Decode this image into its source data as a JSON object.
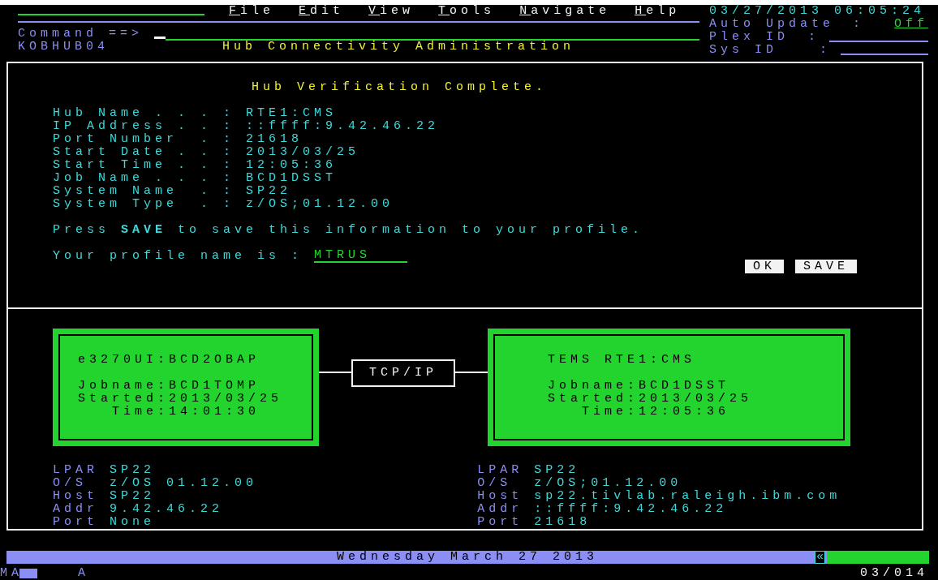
{
  "menu": [
    {
      "label": "File"
    },
    {
      "label": "Edit"
    },
    {
      "label": "View"
    },
    {
      "label": "Tools"
    },
    {
      "label": "Navigate"
    },
    {
      "label": "Help"
    }
  ],
  "header": {
    "command_label": "Command ==>",
    "panel_id": "KOBHUB04",
    "title": "Hub Connectivity Administration",
    "datetime": "03/27/2013 06:05:24",
    "auto_update_label": "Auto Update",
    "auto_update_value": "Off",
    "plex_id_label": "Plex ID",
    "sys_id_label": "Sys ID",
    "separator": ":"
  },
  "verification": {
    "title": "Hub Verification Complete.",
    "fields": [
      {
        "label": "Hub Name . . . :",
        "value": "RTE1:CMS"
      },
      {
        "label": "IP Address . . :",
        "value": "::ffff:9.42.46.22"
      },
      {
        "label": "Port Number  . :",
        "value": "21618"
      },
      {
        "label": "Start Date . . :",
        "value": "2013/03/25"
      },
      {
        "label": "Start Time . . :",
        "value": "12:05:36"
      },
      {
        "label": "Job Name . . . :",
        "value": "BCD1DSST"
      },
      {
        "label": "System Name  . :",
        "value": "SP22"
      },
      {
        "label": "System Type  . :",
        "value": "z/OS;01.12.00"
      }
    ],
    "save_hint": "Press **SAVE** to save this information to your profile.",
    "profile_label": "Your profile name is :",
    "profile_value": "MTRUS",
    "buttons": [
      "OK",
      "SAVE"
    ]
  },
  "connection": {
    "link_label": "TCP/IP",
    "nodes": [
      {
        "title": "e3270UI:BCD2OBAP",
        "lines": [
          "Jobname:BCD1TOMP",
          "Started:2013/03/25",
          "   Time:14:01:30"
        ],
        "info": [
          {
            "label": "LPAR",
            "value": "SP22"
          },
          {
            "label": "O/S",
            "value": "z/OS 01.12.00"
          },
          {
            "label": "Host",
            "value": "SP22"
          },
          {
            "label": "Addr",
            "value": "9.42.46.22"
          },
          {
            "label": "Port",
            "value": "None"
          }
        ]
      },
      {
        "title": "TEMS RTE1:CMS",
        "lines": [
          "Jobname:BCD1DSST",
          "Started:2013/03/25",
          "   Time:12:05:36"
        ],
        "info": [
          {
            "label": "LPAR",
            "value": "SP22"
          },
          {
            "label": "O/S",
            "value": "z/OS;01.12.00"
          },
          {
            "label": "Host",
            "value": "sp22.tivlab.raleigh.ibm.com"
          },
          {
            "label": "Addr",
            "value": "::ffff:9.42.46.22"
          },
          {
            "label": "Port",
            "value": "21618"
          }
        ]
      }
    ]
  },
  "status_bar": {
    "date": "Wednesday March 27 2013",
    "scroll_glyph": "«"
  },
  "oia": {
    "mode": "MA",
    "indicator": "A",
    "cursor_pos": "03/014"
  }
}
